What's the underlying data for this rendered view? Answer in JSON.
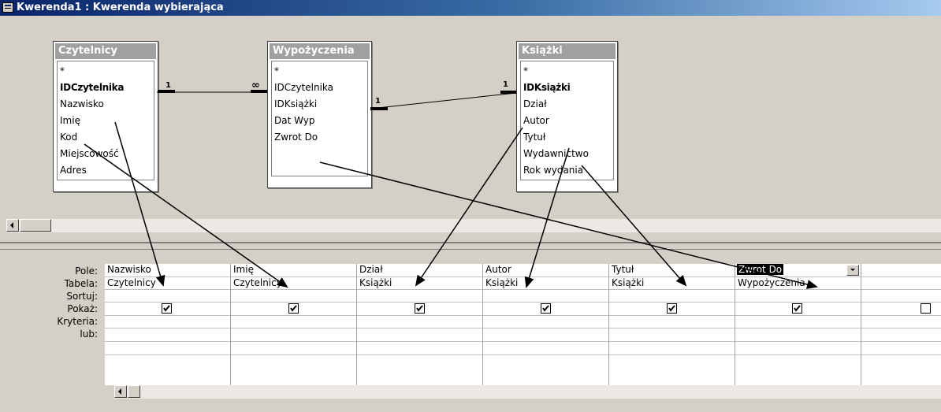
{
  "window": {
    "title": "Kwerenda1 : Kwerenda wybierająca"
  },
  "tables": [
    {
      "name": "Czytelnicy",
      "fields": [
        "*",
        "IDCzytelnika",
        "Nazwisko",
        "Imię",
        "Kod",
        "Miejscowość",
        "Adres"
      ],
      "key_field": "IDCzytelnika"
    },
    {
      "name": "Wypożyczenia",
      "fields": [
        "*",
        "IDCzytelnika",
        "IDKsiążki",
        "Dat Wyp",
        "Zwrot Do"
      ]
    },
    {
      "name": "Książki",
      "fields": [
        "*",
        "IDKsiążki",
        "Dział",
        "Autor",
        "Tytuł",
        "Wydawnictwo",
        "Rok wydania"
      ],
      "key_field": "IDKsiążki"
    }
  ],
  "relationships": [
    {
      "from": "Czytelnicy.IDCzytelnika",
      "to": "Wypożyczenia.IDCzytelnika",
      "from_label": "1",
      "to_label": "∞"
    },
    {
      "from": "Wypożyczenia.IDKsiążki",
      "to": "Książki.IDKsiążki",
      "from_label": "1",
      "to_label": "1"
    }
  ],
  "grid": {
    "row_labels": [
      "Pole:",
      "Tabela:",
      "Sortuj:",
      "Pokaż:",
      "Kryteria:",
      "lub:"
    ],
    "columns": [
      {
        "field": "Nazwisko",
        "table": "Czytelnicy",
        "show": true
      },
      {
        "field": "Imię",
        "table": "Czytelnicy",
        "show": true
      },
      {
        "field": "Dział",
        "table": "Książki",
        "show": true
      },
      {
        "field": "Autor",
        "table": "Książki",
        "show": true
      },
      {
        "field": "Tytuł",
        "table": "Książki",
        "show": true
      },
      {
        "field": "Zwrot Do",
        "table": "Wypożyczenia",
        "show": true,
        "selected": true
      },
      {
        "field": "",
        "table": "",
        "show": false
      }
    ]
  },
  "colors": {
    "title_start": "#0a246a",
    "title_end": "#a6caf0",
    "face": "#d4d0c8",
    "table_header": "#a0a0a0"
  }
}
